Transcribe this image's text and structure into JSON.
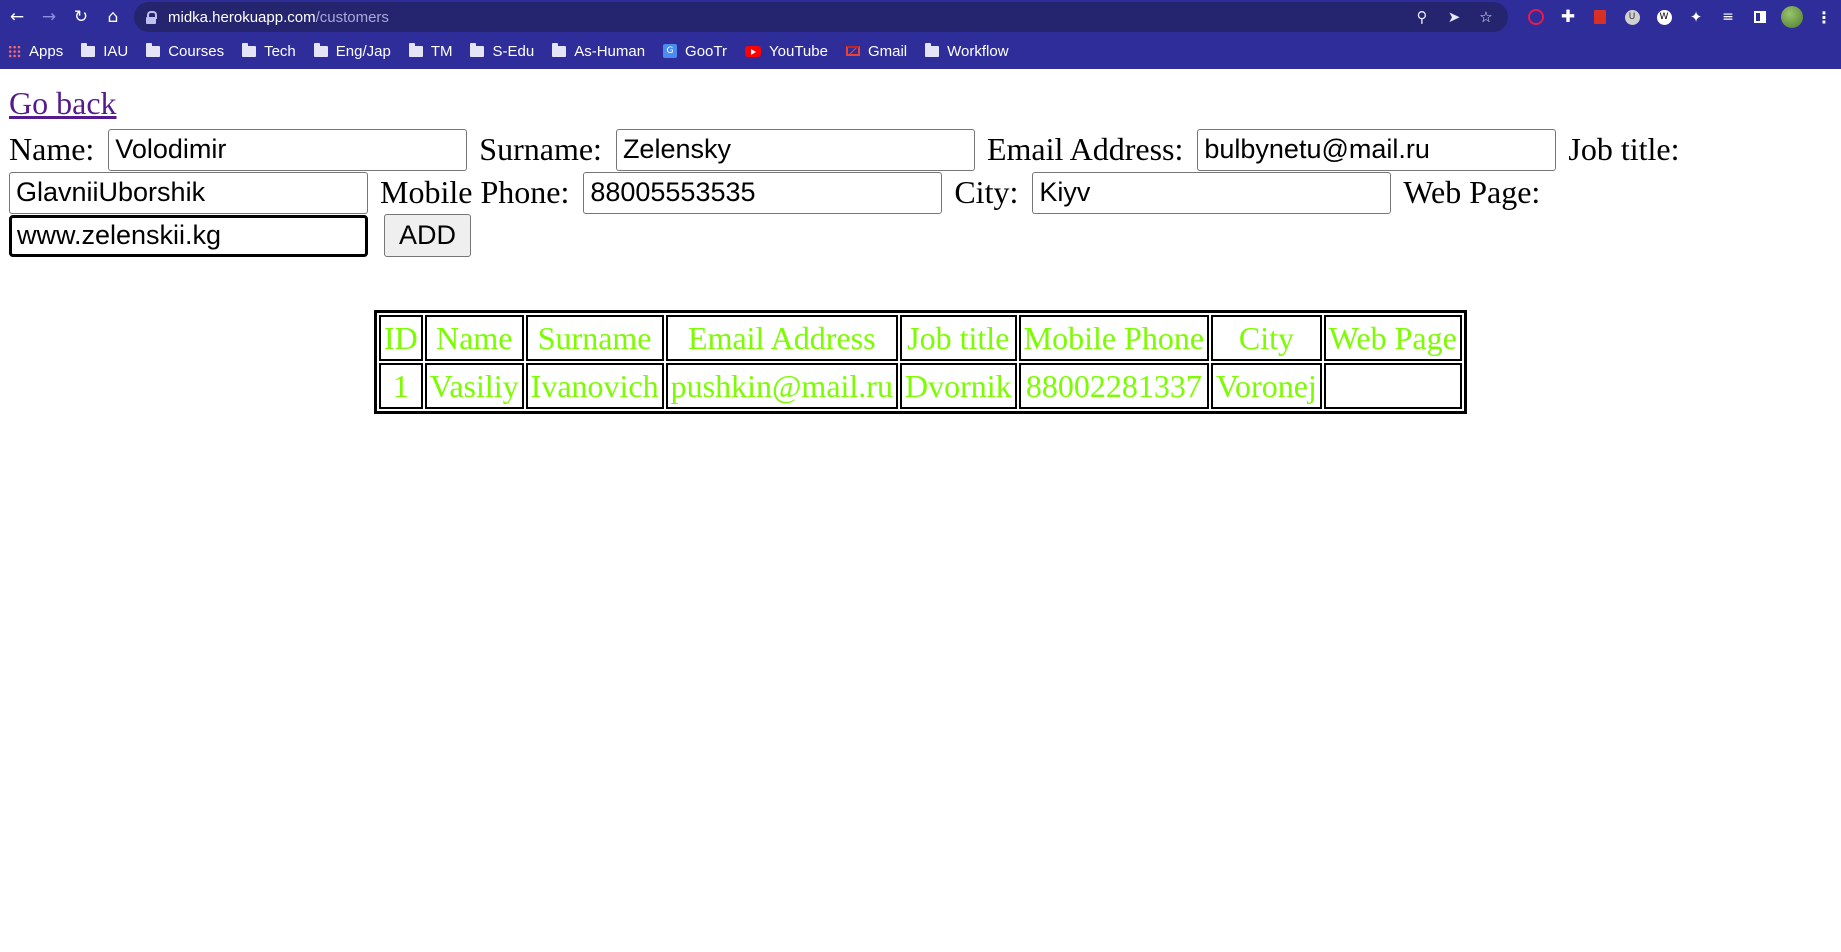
{
  "browser": {
    "url_host": "midka.herokuapp.com",
    "url_path": "/customers",
    "bookmarks": [
      {
        "label": "Apps",
        "icon": "apps-grid-icon"
      },
      {
        "label": "IAU",
        "icon": "folder-icon"
      },
      {
        "label": "Courses",
        "icon": "folder-icon"
      },
      {
        "label": "Tech",
        "icon": "folder-icon"
      },
      {
        "label": "Eng/Jap",
        "icon": "folder-icon"
      },
      {
        "label": "TM",
        "icon": "folder-icon"
      },
      {
        "label": "S-Edu",
        "icon": "folder-icon"
      },
      {
        "label": "As-Human",
        "icon": "folder-icon"
      },
      {
        "label": "GooTr",
        "icon": "google-translate-icon"
      },
      {
        "label": "YouTube",
        "icon": "youtube-icon"
      },
      {
        "label": "Gmail",
        "icon": "gmail-icon"
      },
      {
        "label": "Workflow",
        "icon": "folder-icon"
      }
    ]
  },
  "page": {
    "go_back": "Go back",
    "form": {
      "name_label": "Name:",
      "name_value": "Volodimir",
      "surname_label": "Surname:",
      "surname_value": "Zelensky",
      "email_label": "Email Address:",
      "email_value": "bulbynetu@mail.ru",
      "job_label": "Job title:",
      "job_value": "GlavniiUborshik",
      "mobile_label": "Mobile Phone:",
      "mobile_value": "88005553535",
      "city_label": "City:",
      "city_value": "Kiyv",
      "web_label": "Web Page:",
      "web_value": "www.zelenskii.kg",
      "add_button": "ADD"
    },
    "table": {
      "headers": [
        "ID",
        "Name",
        "Surname",
        "Email Address",
        "Job title",
        "Mobile Phone",
        "City",
        "Web Page"
      ],
      "rows": [
        [
          "1",
          "Vasiliy",
          "Ivanovich",
          "pushkin@mail.ru",
          "Dvornik",
          "88002281337",
          "Voronej",
          ""
        ]
      ],
      "text_color": "#7cfc00"
    }
  }
}
